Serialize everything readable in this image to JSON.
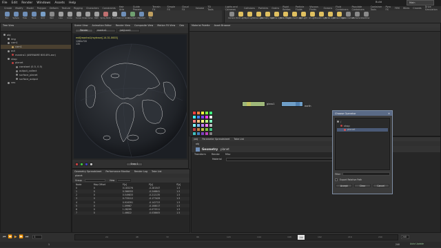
{
  "menubar": {
    "items": [
      "File",
      "Edit",
      "Render",
      "Windows",
      "Assets",
      "Help"
    ],
    "right_label": "Build",
    "desktop": "Main"
  },
  "shelf_tabs_left": [
    "Create",
    "Modify",
    "Model",
    "Polygon",
    "Deform",
    "Texture",
    "Rigging",
    "Characters",
    "Constraints",
    "Hair Utils",
    "Guide Process",
    "Terrain FX",
    "Simple FX",
    "Cloud FX",
    "Volume",
    "TD Tools"
  ],
  "shelf_tools_left": [
    {
      "label": "Box",
      "color": "#6f8fb8"
    },
    {
      "label": "Sphere",
      "color": "#6f8fb8"
    },
    {
      "label": "Tube",
      "color": "#6f8fb8"
    },
    {
      "label": "Torus",
      "color": "#6f8fb8"
    },
    {
      "label": "Grid",
      "color": "#7aa0c8"
    },
    {
      "label": "Null",
      "color": "#8a8a8a"
    },
    {
      "label": "Line",
      "color": "#a0a0a0"
    },
    {
      "label": "Circle",
      "color": "#a0a0a0"
    },
    {
      "label": "Curve",
      "color": "#a0a0a0"
    },
    {
      "label": "Draw Curve",
      "color": "#a0a0a0"
    },
    {
      "label": "Path",
      "color": "#a0a0a0"
    },
    {
      "label": "Spray Paint",
      "color": "#c07070"
    },
    {
      "label": "Font",
      "color": "#b0b0b0"
    },
    {
      "label": "Platonic Solids",
      "color": "#6f8fb8"
    },
    {
      "label": "L-System",
      "color": "#70a070"
    },
    {
      "label": "Metaball",
      "color": "#6f8fb8"
    },
    {
      "label": "File",
      "color": "#c0a060"
    }
  ],
  "shelf_tabs_right": [
    "Lights and Cameras",
    "Collisions",
    "Particles",
    "Grains",
    "Rigid Bodies",
    "Particle Fluids",
    "Viscous Fluids",
    "Oceans",
    "Fluid Containers",
    "Populate Containers",
    "Container Tools",
    "Pyro FX",
    "FEM",
    "Wires",
    "Crowds",
    "Drive Simulation"
  ],
  "shelf_tools_right": [
    {
      "label": "Camera",
      "color": "#8a8a8a"
    },
    {
      "label": "Point Light",
      "color": "#e0c060"
    },
    {
      "label": "Spot Light",
      "color": "#e0c060"
    },
    {
      "label": "Area Light",
      "color": "#e0c060"
    },
    {
      "label": "Geometry Light",
      "color": "#e0c060"
    },
    {
      "label": "Volume Light",
      "color": "#e0c060"
    },
    {
      "label": "Distant Light",
      "color": "#e0c060"
    },
    {
      "label": "Environment Light",
      "color": "#e0c060"
    },
    {
      "label": "Sky Light",
      "color": "#e0c060"
    },
    {
      "label": "GI Light",
      "color": "#e0c060"
    },
    {
      "label": "Caustic Light",
      "color": "#e0c060"
    },
    {
      "label": "Portal Light",
      "color": "#e0c060"
    },
    {
      "label": "Ambient Light",
      "color": "#e0c060"
    },
    {
      "label": "Stereo Camera",
      "color": "#8a8a8a"
    },
    {
      "label": "VR Camera",
      "color": "#8a8a8a"
    },
    {
      "label": "Switcher",
      "color": "#8a8a8a"
    }
  ],
  "tree_panel": {
    "tabs": [
      "Tree View"
    ],
    "items": [
      {
        "label": "obj",
        "depth": 0,
        "color": "#9a9a9a"
      },
      {
        "label": "img",
        "depth": 1,
        "color": "#9a9a9a"
      },
      {
        "label": "cam1",
        "depth": 1,
        "color": "#9a9a9a"
      },
      {
        "label": "cam1",
        "depth": 2,
        "color": "#c0a060",
        "selected": true
      },
      {
        "label": "out",
        "depth": 1,
        "color": "#9a9a9a"
      },
      {
        "label": "mantra1 (ANYNAME 600.8%.exr)",
        "depth": 2,
        "color": "#c04040"
      },
      {
        "label": "shop",
        "depth": 1,
        "color": "#9a9a9a"
      },
      {
        "label": "planet",
        "depth": 2,
        "color": "#c04040"
      },
      {
        "label": "constant (0.5, 0.5)",
        "depth": 3,
        "color": "#8a8a8a"
      },
      {
        "label": "output_collect",
        "depth": 3,
        "color": "#8a8a8a"
      },
      {
        "label": "surface_planet",
        "depth": 3,
        "color": "#8a8a8a"
      },
      {
        "label": "surface_output",
        "depth": 3,
        "color": "#8a8a8a"
      },
      {
        "label": "vex",
        "depth": 1,
        "color": "#9a9a9a"
      }
    ]
  },
  "viewer": {
    "tabs": [
      "Scene View",
      "Animation Editor",
      "Render View",
      "Composite View",
      "Motion FX View",
      "Geo"
    ],
    "render_label": "Render",
    "renderer": "mantra1",
    "camera": "/obj/cam1",
    "stats": "mdi[mantra1/raytrace[-14.31.0003]",
    "res": "1280x720",
    "frame_label": "135",
    "snap_label": "Snap 1"
  },
  "network": {
    "tabs": [
      "Material Palette",
      "Asset Browser"
    ],
    "nodes": [
      {
        "name": "glass1"
      },
      {
        "name": "earth"
      }
    ]
  },
  "param_panel": {
    "tabs": [
      "/obj",
      "Parameter Spreadsheet",
      "Take List"
    ],
    "path": "obj",
    "node_title": "Geometry",
    "node_name": "planet",
    "subtabs": [
      "Transform",
      "Render",
      "Misc"
    ],
    "material_label": "Material"
  },
  "dialog": {
    "title": "Choose Operator",
    "tree": [
      "/",
      "shop",
      "planet"
    ],
    "filter_label": "Filter",
    "checkbox_label": "Export Relative Path",
    "buttons": [
      "Accept",
      "Clear",
      "Cancel"
    ]
  },
  "spreadsheet": {
    "tabs": [
      "Geometry Spreadsheet",
      "Performance Monitor",
      "Render Log",
      "Take List"
    ],
    "node": "planet",
    "group_label": "Group",
    "view_label": "View",
    "columns": [
      "Node",
      "Map Offset",
      "P[x]",
      "P[y]",
      "P[z]"
    ],
    "rows": [
      [
        "0",
        "0",
        "0.183276",
        "-0.281547",
        "1.5"
      ],
      [
        "1",
        "0",
        "0.366555",
        "-0.246841",
        "1.5"
      ],
      [
        "2",
        "0",
        "0.549833",
        "-0.212135",
        "1.5"
      ],
      [
        "3",
        "0",
        "0.733112",
        "-0.177429",
        "1.5"
      ],
      [
        "4",
        "0",
        "0.916391",
        "-0.142723",
        "1.5"
      ],
      [
        "5",
        "0",
        "1.09967",
        "-0.108017",
        "1.5"
      ],
      [
        "6",
        "0",
        "1.28295",
        "-0.073311",
        "1.5"
      ],
      [
        "7",
        "0",
        "1.46622",
        "-0.038605",
        "1.5"
      ]
    ]
  },
  "timeline": {
    "frame": "1",
    "start": "1",
    "end": "240",
    "current": "150",
    "ticks": [
      "24",
      "48",
      "72",
      "96",
      "120",
      "144",
      "168",
      "192",
      "216",
      "240"
    ],
    "right_end": "240",
    "status": "Auto Update"
  },
  "palette_colors": [
    "#ff4040",
    "#ff8040",
    "#ffff40",
    "#80ff40",
    "#40ff80",
    "#40ffff",
    "#4080ff",
    "#8040ff",
    "#ff40ff",
    "#ffffff",
    "#ff8080",
    "#ffc080",
    "#ffff80",
    "#c0ff80",
    "#80ffc0",
    "#80ffff",
    "#80c0ff",
    "#c080ff",
    "#ff80ff",
    "#c0c0c0",
    "#c04040",
    "#c08040",
    "#c0c040",
    "#80c040",
    "#40c080",
    "#40c0c0",
    "#4080c0",
    "#8040c0",
    "#c040c0",
    "#808080",
    "#802020",
    "#804020",
    "#808020",
    "#408020",
    "#208040",
    "#208080",
    "#204080",
    "#402080",
    "#802080",
    "#404040"
  ]
}
